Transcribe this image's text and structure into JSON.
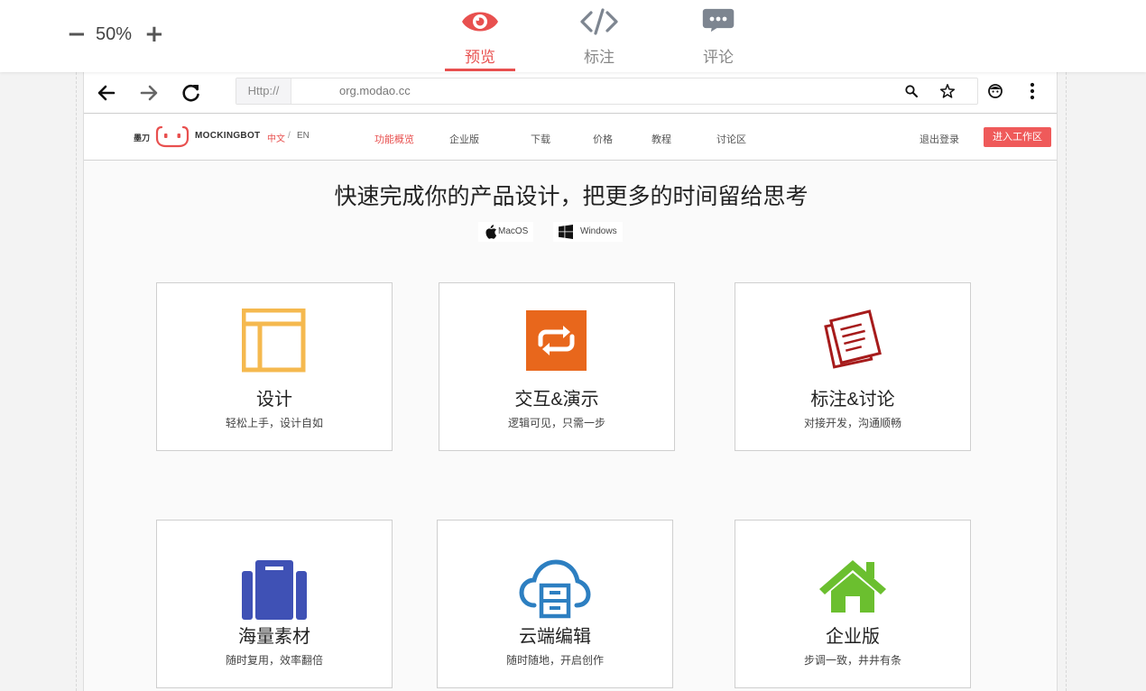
{
  "toolbar": {
    "zoom_minus": "−",
    "zoom_value": "50%",
    "zoom_plus": "+",
    "tabs": [
      {
        "label": "预览",
        "icon": "eye-icon",
        "active": true
      },
      {
        "label": "标注",
        "icon": "code-icon",
        "active": false
      },
      {
        "label": "评论",
        "icon": "comment-icon",
        "active": false
      }
    ]
  },
  "browser": {
    "url_prefix": "Http://",
    "url": "org.modao.cc"
  },
  "site_nav": {
    "logo_zh": "墨刀",
    "brand": "MOCKINGBOT",
    "lang_zh": "中文",
    "lang_sep": "/",
    "lang_en": "EN",
    "links": [
      "功能概览",
      "企业版",
      "下载",
      "价格",
      "教程",
      "讨论区"
    ],
    "logout": "退出登录",
    "cta": "进入工作区"
  },
  "hero": {
    "headline": "快速完成你的产品设计，把更多的时间留给思考",
    "mac_label": "MacOS",
    "win_label": "Windows"
  },
  "features": [
    {
      "title": "设计",
      "subtitle": "轻松上手，设计自如",
      "icon": "layout-icon",
      "color": "#f5b94f"
    },
    {
      "title": "交互&演示",
      "subtitle": "逻辑可见，只需一步",
      "icon": "repeat-icon",
      "color": "#e8671c"
    },
    {
      "title": "标注&讨论",
      "subtitle": "对接开发，沟通顺畅",
      "icon": "notes-icon",
      "color": "#a61b1b"
    },
    {
      "title": "海量素材",
      "subtitle": "随时复用，效率翻倍",
      "icon": "suitcase-icon",
      "color": "#3f51b5"
    },
    {
      "title": "云端编辑",
      "subtitle": "随时随地，开启创作",
      "icon": "cloud-icon",
      "color": "#2d7fc1"
    },
    {
      "title": "企业版",
      "subtitle": "步调一致，井井有条",
      "icon": "home-icon",
      "color": "#6bbf2f"
    }
  ],
  "accent_color": "#e8504f"
}
